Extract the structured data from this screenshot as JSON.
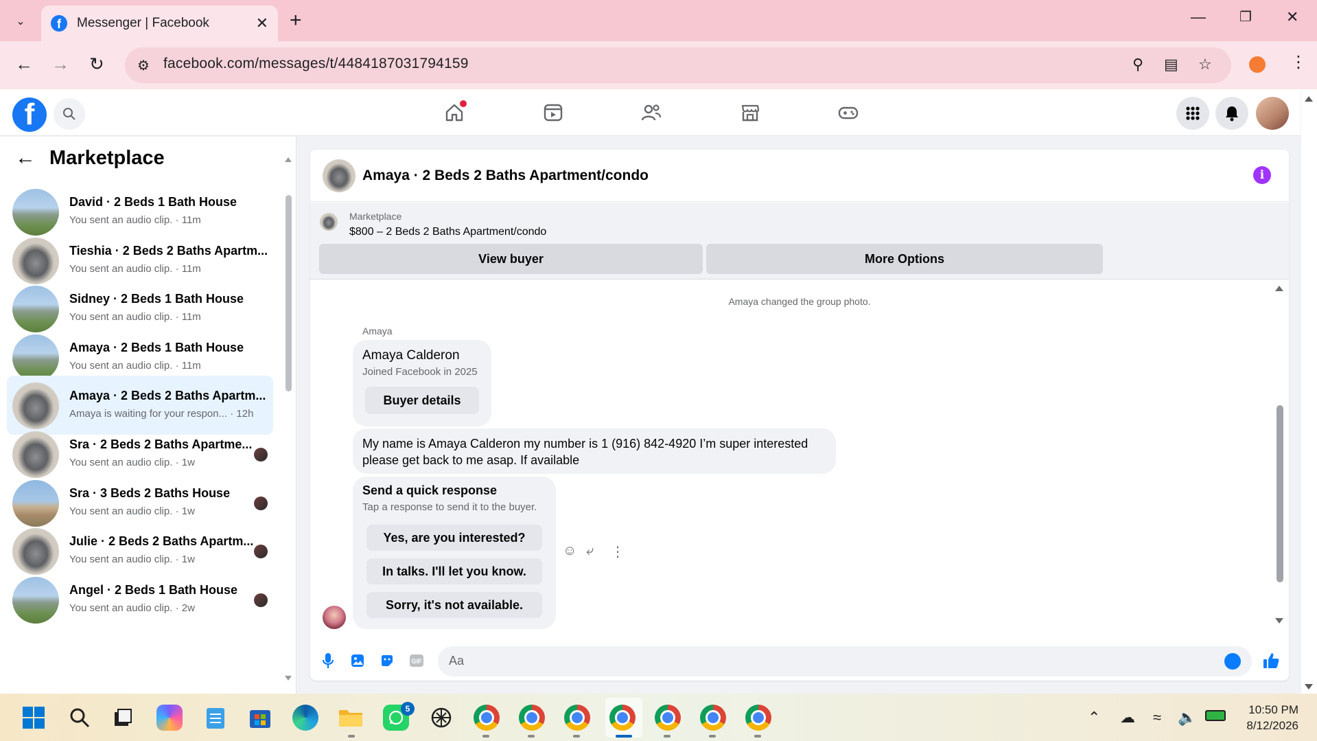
{
  "browser": {
    "tab_title": "Messenger | Facebook",
    "url": "facebook.com/messages/t/4484187031794159"
  },
  "marketplace": {
    "title": "Marketplace",
    "conversations": [
      {
        "name": "David · 2 Beds 1 Bath House",
        "sub": "You sent an audio clip. · 11m",
        "thumb": "house"
      },
      {
        "name": "Tieshia · 2 Beds 2 Baths Apartm...",
        "sub": "You sent an audio clip. · 11m",
        "thumb": "door"
      },
      {
        "name": "Sidney · 2 Beds 1 Bath House",
        "sub": "You sent an audio clip. · 11m",
        "thumb": "house"
      },
      {
        "name": "Amaya · 2 Beds 1 Bath House",
        "sub": "You sent an audio clip. · 11m",
        "thumb": "house"
      },
      {
        "name": "Amaya · 2 Beds 2 Baths Apartm...",
        "sub": "Amaya is waiting for your respon... · 12h",
        "thumb": "door",
        "active": true
      },
      {
        "name": "Sra · 2 Beds 2 Baths Apartme...",
        "sub": "You sent an audio clip. · 1w",
        "thumb": "door"
      },
      {
        "name": "Sra · 3 Beds 2 Baths House",
        "sub": "You sent an audio clip. · 1w",
        "thumb": "ranch"
      },
      {
        "name": "Julie · 2 Beds 2 Baths Apartm...",
        "sub": "You sent an audio clip. · 1w",
        "thumb": "door"
      },
      {
        "name": "Angel · 2 Beds 1 Bath House",
        "sub": "You sent an audio clip. · 2w",
        "thumb": "house"
      }
    ]
  },
  "chat": {
    "title": "Amaya · 2 Beds 2 Baths Apartment/condo",
    "banner_label": "Marketplace",
    "banner_item": "$800 – 2 Beds 2 Baths Apartment/condo",
    "view_buyer": "View buyer",
    "more_options": "More Options",
    "system_note": "Amaya changed the group photo.",
    "sender": "Amaya",
    "profile_name": "Amaya Calderon",
    "profile_sub": "Joined Facebook in 2025",
    "buyer_details": "Buyer details",
    "message": "My name is Amaya Calderon my number is 1 (916) 842-4920 I’m super interested please get back to me asap. If available",
    "quick_title": "Send a quick response",
    "quick_sub": "Tap a response to send it to the buyer.",
    "quick_replies": [
      "Yes, are you interested?",
      "In talks. I'll let you know.",
      "Sorry, it's not available."
    ],
    "composer_placeholder": "Aa"
  },
  "taskbar": {
    "whatsapp_badge": "5",
    "time": "10:50 PM",
    "date": "8/12/2026"
  },
  "colors": {
    "fb_blue": "#1877f2",
    "messenger_blue": "#0a7cff",
    "info_purple": "#a033ff",
    "tab_strip": "#f7c8d2"
  }
}
